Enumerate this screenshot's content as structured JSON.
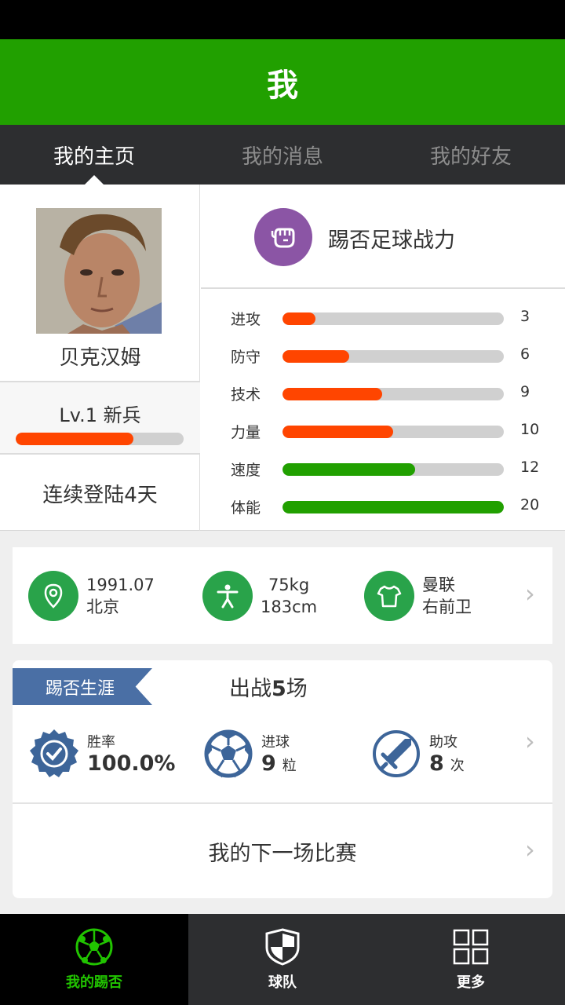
{
  "header": {
    "title": "我"
  },
  "tabs": [
    {
      "label": "我的主页",
      "active": true
    },
    {
      "label": "我的消息",
      "active": false
    },
    {
      "label": "我的好友",
      "active": false
    }
  ],
  "profile": {
    "name": "贝克汉姆",
    "level_text": "Lv.1 新兵",
    "level_progress": 0.7,
    "login_text": "连续登陆4天"
  },
  "power": {
    "title": "踢否足球战力",
    "stats": [
      {
        "label": "进攻",
        "value": "3",
        "fill": 0.15,
        "color": "#ff4500"
      },
      {
        "label": "防守",
        "value": "6",
        "fill": 0.3,
        "color": "#ff4500"
      },
      {
        "label": "技术",
        "value": "9",
        "fill": 0.45,
        "color": "#ff4500"
      },
      {
        "label": "力量",
        "value": "10",
        "fill": 0.5,
        "color": "#ff4500"
      },
      {
        "label": "速度",
        "value": "12",
        "fill": 0.6,
        "color": "#21a000"
      },
      {
        "label": "体能",
        "value": "20",
        "fill": 1.0,
        "color": "#21a000"
      }
    ]
  },
  "info": {
    "birth": "1991.07",
    "city": "北京",
    "weight": "75kg",
    "height": "183cm",
    "club": "曼联",
    "position": "右前卫"
  },
  "career": {
    "ribbon": "踢否生涯",
    "title_prefix": "出战",
    "title_count": "5",
    "title_suffix": "场",
    "win_label": "胜率",
    "win_value": "100.0%",
    "goals_label": "进球",
    "goals_value": "9",
    "goals_unit": "粒",
    "assists_label": "助攻",
    "assists_value": "8",
    "assists_unit": "次",
    "next_match": "我的下一场比赛"
  },
  "nav": [
    {
      "label": "我的踢否",
      "icon": "soccer-ball-icon",
      "active": true
    },
    {
      "label": "球队",
      "icon": "shield-icon",
      "active": false
    },
    {
      "label": "更多",
      "icon": "grid-icon",
      "active": false
    }
  ],
  "colors": {
    "brand_green": "#21a000",
    "stat_orange": "#ff4500",
    "power_purple": "#8b55a5",
    "info_green": "#29a34a",
    "career_blue": "#4a6fa5"
  }
}
